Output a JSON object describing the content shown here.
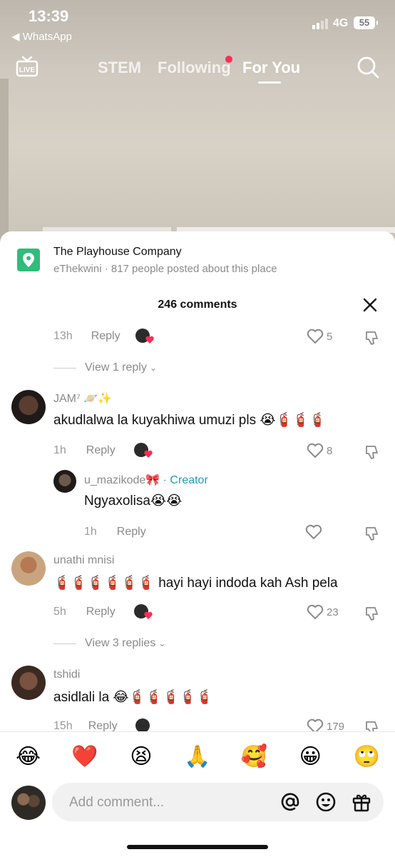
{
  "status": {
    "time": "13:39",
    "back_app": "◀ WhatsApp",
    "network": "4G",
    "battery": "55"
  },
  "topnav": {
    "tabs": [
      {
        "label": "STEM"
      },
      {
        "label": "Following"
      },
      {
        "label": "For You"
      }
    ],
    "live_label": "LIVE"
  },
  "place": {
    "name": "The Playhouse Company",
    "subtitle": "eThekwini · 817 people posted about this place"
  },
  "comments_title": "246 comments",
  "comments": [
    {
      "time": "13h",
      "reply": "Reply",
      "likes": "5",
      "view_replies": "View 1 reply"
    },
    {
      "user": "JAM⁷ 🪐✨",
      "text": "akudlalwa la kuyakhiwa umuzi pls 😭🧯🧯🧯",
      "time": "1h",
      "reply": "Reply",
      "likes": "8",
      "reply_comment": {
        "user": "u_mazikode🎀",
        "badge": "· Creator",
        "text": "Ngyaxolisa😭😭",
        "time": "1h",
        "reply": "Reply"
      }
    },
    {
      "user": "unathi mnisi",
      "text": "🧯🧯🧯🧯🧯🧯 hayi hayi indoda kah Ash pela",
      "time": "5h",
      "reply": "Reply",
      "likes": "23",
      "view_replies": "View 3 replies"
    },
    {
      "user": "tshidi",
      "text": "asidlali la 😂🧯🧯🧯🧯🧯",
      "time": "15h",
      "reply": "Reply",
      "likes": "179"
    }
  ],
  "emoji_bar": [
    "😂",
    "❤️",
    "😫",
    "🙏",
    "🥰",
    "😀",
    "🙄"
  ],
  "compose": {
    "placeholder": "Add comment..."
  },
  "colors": {
    "accent": "#fe2c55",
    "creator": "#1a9fb8",
    "place_icon": "#2ebd7a"
  }
}
